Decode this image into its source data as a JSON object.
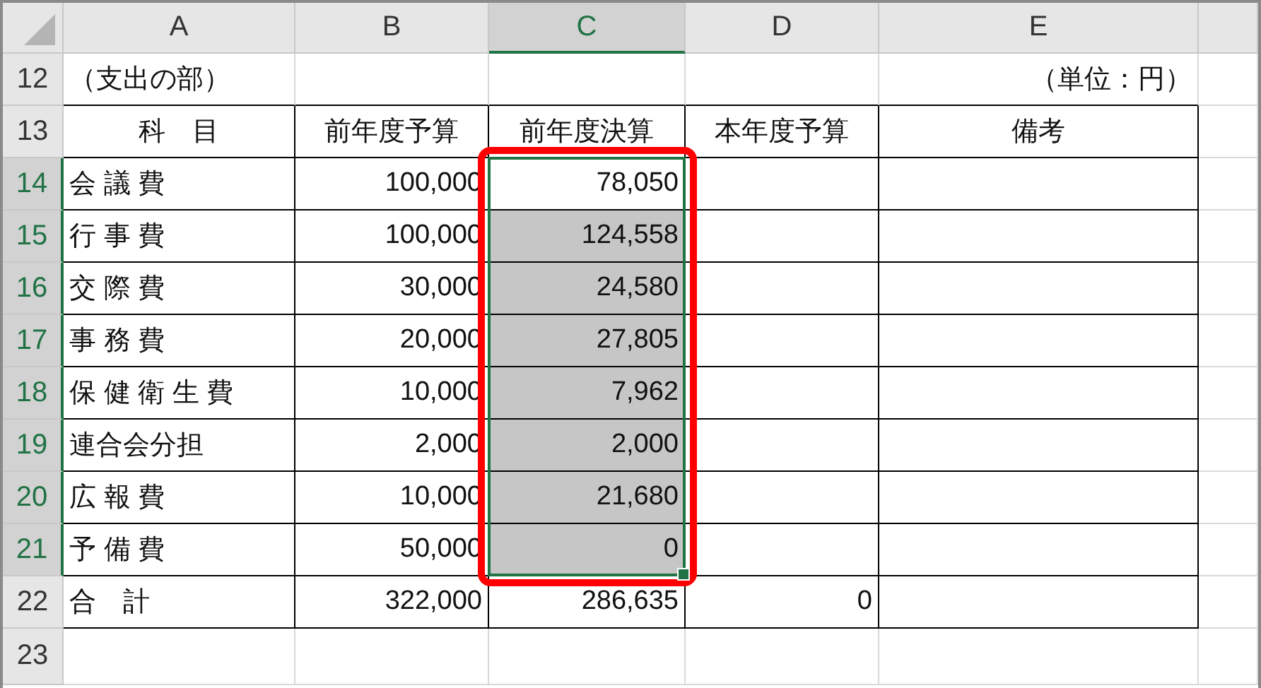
{
  "columns": [
    {
      "label": "A",
      "selected": false
    },
    {
      "label": "B",
      "selected": false
    },
    {
      "label": "C",
      "selected": true
    },
    {
      "label": "D",
      "selected": false
    },
    {
      "label": "E",
      "selected": false
    }
  ],
  "rows": [
    {
      "number": "12",
      "kind": "caption",
      "selected": false,
      "cells": [
        {
          "text": "（支出の部）",
          "shaded": false
        },
        {
          "shaded": false
        },
        {
          "shaded": false
        },
        {
          "shaded": false
        },
        {
          "text": "（単位：円）",
          "shaded": false
        }
      ]
    },
    {
      "number": "13",
      "kind": "heading",
      "selected": false,
      "cells": [
        {
          "text": "科　目",
          "shaded": false
        },
        {
          "text": "前年度予算",
          "shaded": false
        },
        {
          "text": "前年度決算",
          "shaded": false
        },
        {
          "text": "本年度予算",
          "shaded": false
        },
        {
          "text": "備考",
          "shaded": false
        }
      ]
    },
    {
      "number": "14",
      "kind": "item",
      "selected": true,
      "cells": [
        {
          "text": "会 議 費",
          "shaded": false
        },
        {
          "text": "100,000",
          "shaded": false
        },
        {
          "text": "78,050",
          "shaded": false
        },
        {
          "shaded": false
        },
        {
          "shaded": false
        }
      ]
    },
    {
      "number": "15",
      "kind": "item",
      "selected": true,
      "cells": [
        {
          "text": "行 事 費",
          "shaded": false
        },
        {
          "text": "100,000",
          "shaded": false
        },
        {
          "text": "124,558",
          "shaded": true
        },
        {
          "shaded": false
        },
        {
          "shaded": false
        }
      ]
    },
    {
      "number": "16",
      "kind": "item",
      "selected": true,
      "cells": [
        {
          "text": "交 際 費",
          "shaded": false
        },
        {
          "text": "30,000",
          "shaded": false
        },
        {
          "text": "24,580",
          "shaded": true
        },
        {
          "shaded": false
        },
        {
          "shaded": false
        }
      ]
    },
    {
      "number": "17",
      "kind": "item",
      "selected": true,
      "cells": [
        {
          "text": "事 務 費",
          "shaded": false
        },
        {
          "text": "20,000",
          "shaded": false
        },
        {
          "text": "27,805",
          "shaded": true
        },
        {
          "shaded": false
        },
        {
          "shaded": false
        }
      ]
    },
    {
      "number": "18",
      "kind": "item",
      "selected": true,
      "cells": [
        {
          "text": "保 健 衛 生 費",
          "shaded": false
        },
        {
          "text": "10,000",
          "shaded": false
        },
        {
          "text": "7,962",
          "shaded": true
        },
        {
          "shaded": false
        },
        {
          "shaded": false
        }
      ]
    },
    {
      "number": "19",
      "kind": "item",
      "selected": true,
      "cells": [
        {
          "text": "連合会分担",
          "shaded": false
        },
        {
          "text": "2,000",
          "shaded": false
        },
        {
          "text": "2,000",
          "shaded": true
        },
        {
          "shaded": false
        },
        {
          "shaded": false
        }
      ]
    },
    {
      "number": "20",
      "kind": "item",
      "selected": true,
      "cells": [
        {
          "text": "広 報 費",
          "shaded": false
        },
        {
          "text": "10,000",
          "shaded": false
        },
        {
          "text": "21,680",
          "shaded": true
        },
        {
          "shaded": false
        },
        {
          "shaded": false
        }
      ]
    },
    {
      "number": "21",
      "kind": "item",
      "selected": true,
      "cells": [
        {
          "text": "予 備 費",
          "shaded": false
        },
        {
          "text": "50,000",
          "shaded": false
        },
        {
          "text": "0",
          "shaded": true
        },
        {
          "shaded": false
        },
        {
          "shaded": false
        }
      ]
    },
    {
      "number": "22",
      "kind": "item",
      "selected": false,
      "cells": [
        {
          "text": "合　計",
          "shaded": false
        },
        {
          "text": "322,000",
          "shaded": false
        },
        {
          "text": "286,635",
          "shaded": false
        },
        {
          "text": "0",
          "shaded": false
        },
        {
          "shaded": false
        }
      ]
    },
    {
      "number": "23",
      "kind": "blank",
      "selected": false,
      "cells": [
        {
          "shaded": false
        },
        {
          "shaded": false
        },
        {
          "shaded": false
        },
        {
          "shaded": false
        },
        {
          "shaded": false
        }
      ]
    }
  ],
  "selection_frame": {
    "shown": true
  }
}
